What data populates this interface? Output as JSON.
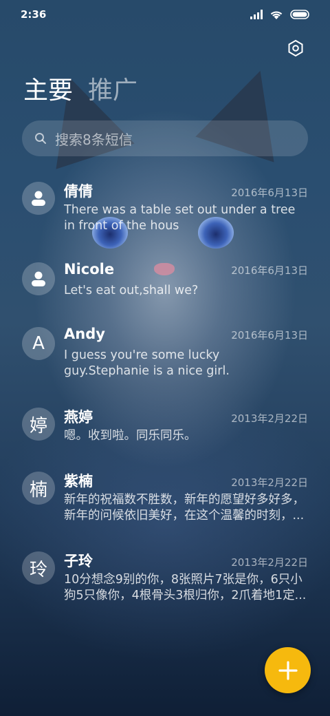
{
  "status_bar": {
    "time": "2:36",
    "icons": [
      "signal-icon",
      "wifi-icon",
      "battery-icon"
    ]
  },
  "header": {
    "settings_icon": "settings-hexagon-icon",
    "tabs": [
      {
        "label": "主要",
        "active": true
      },
      {
        "label": "推广",
        "active": false
      }
    ]
  },
  "search": {
    "icon": "search-icon",
    "placeholder": "搜索8条短信"
  },
  "messages": [
    {
      "avatar": "",
      "avatar_icon": "person-icon",
      "name": "倩倩",
      "date": "2016年6月13日",
      "snippet": "There was a table set out under a tree in front of the hous"
    },
    {
      "avatar": "",
      "avatar_icon": "person-icon",
      "name": "Nicole",
      "date": "2016年6月13日",
      "snippet": "Let's eat out,shall we?"
    },
    {
      "avatar": "A",
      "name": "Andy",
      "date": "2016年6月13日",
      "snippet": "I guess you're some lucky guy.Stephanie is a nice girl."
    },
    {
      "avatar": "婷",
      "name": "燕婷",
      "date": "2013年2月22日",
      "snippet": "嗯。收到啦。同乐同乐。"
    },
    {
      "avatar": "楠",
      "name": "紫楠",
      "date": "2013年2月22日",
      "snippet": "新年的祝福数不胜数，新年的愿望好多好多，新年的问候依旧美好，在这个温馨的时刻，..."
    },
    {
      "avatar": "玲",
      "name": "子玲",
      "date": "2013年2月22日",
      "snippet": "10分想念9别的你，8张照片7张是你，6只小狗5只像你，4根骨头3根归你，2爪着地1定..."
    }
  ],
  "fab": {
    "icon": "plus-icon"
  },
  "colors": {
    "accent": "#f6b90e"
  }
}
